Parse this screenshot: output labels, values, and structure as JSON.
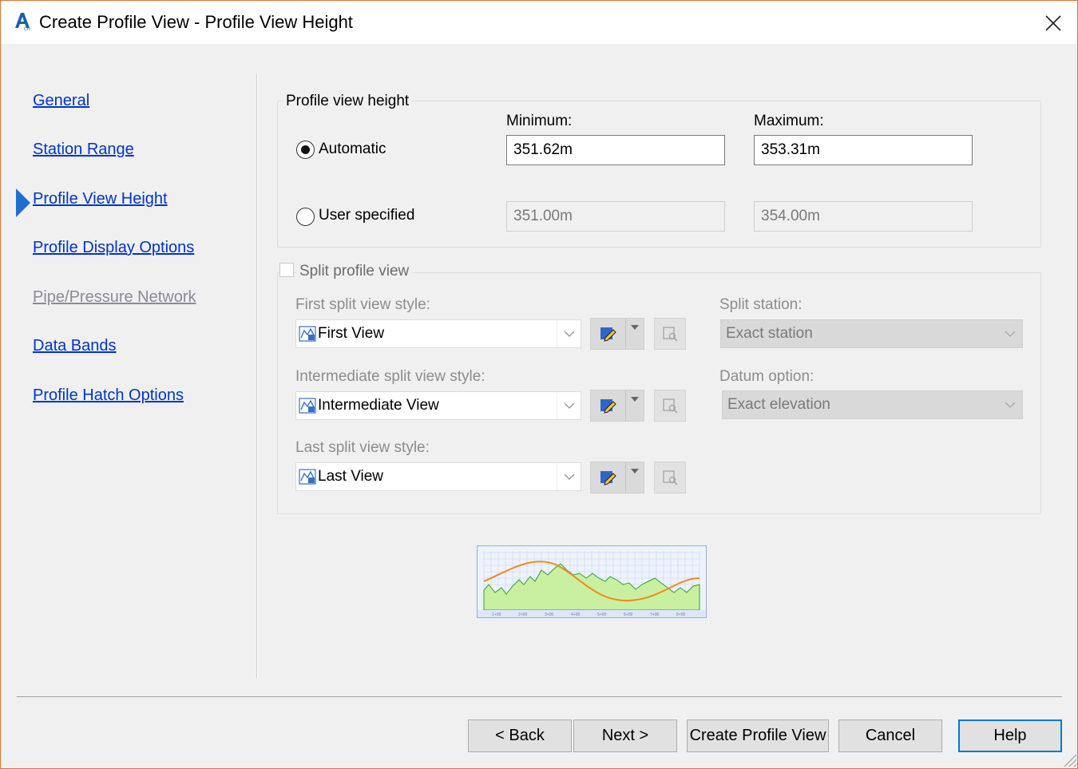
{
  "window": {
    "title": "Create Profile View - Profile View Height",
    "app_icon": "autocad-civil-icon",
    "close_icon": "close-icon",
    "accent_color": "#0078d7",
    "border_color": "#e0733a"
  },
  "nav": {
    "items": [
      {
        "label": "General",
        "enabled": true
      },
      {
        "label": "Station Range",
        "enabled": true
      },
      {
        "label": "Profile View Height",
        "enabled": true,
        "current": true
      },
      {
        "label": "Profile Display Options",
        "enabled": true
      },
      {
        "label": "Pipe/Pressure Network",
        "enabled": false
      },
      {
        "label": "Data Bands",
        "enabled": true
      },
      {
        "label": "Profile Hatch Options",
        "enabled": true
      }
    ],
    "link_color": "#0033cc",
    "disabled_color": "#8a8a9a"
  },
  "height": {
    "group_title": "Profile view height",
    "minimum_label": "Minimum:",
    "maximum_label": "Maximum:",
    "automatic": {
      "label": "Automatic",
      "selected": true,
      "min": "351.62m",
      "max": "353.31m"
    },
    "user": {
      "label": "User specified",
      "selected": false,
      "min": "351.00m",
      "max": "354.00m"
    }
  },
  "split": {
    "label": "Split profile view",
    "checked": false,
    "first_label": "First split view style:",
    "first_value": "First View",
    "intermediate_label": "Intermediate split view style:",
    "intermediate_value": "Intermediate View",
    "last_label": "Last split view style:",
    "last_value": "Last View",
    "station_label": "Split station:",
    "station_value": "Exact station",
    "datum_label": "Datum option:",
    "datum_value": "Exact elevation",
    "style_icon": "profile-view-style-icon",
    "edit_icon": "edit-style-icon",
    "view_icon": "preview-icon"
  },
  "preview": {
    "station_labels": [
      "1+00",
      "2+00",
      "3+00",
      "4+00",
      "5+00",
      "6+00",
      "7+00",
      "8+00"
    ],
    "ground_color": "#c8f0a0",
    "line_color": "#f08a1e"
  },
  "buttons": {
    "back": "< Back",
    "next": "Next >",
    "create": "Create Profile View",
    "cancel": "Cancel",
    "help": "Help"
  }
}
